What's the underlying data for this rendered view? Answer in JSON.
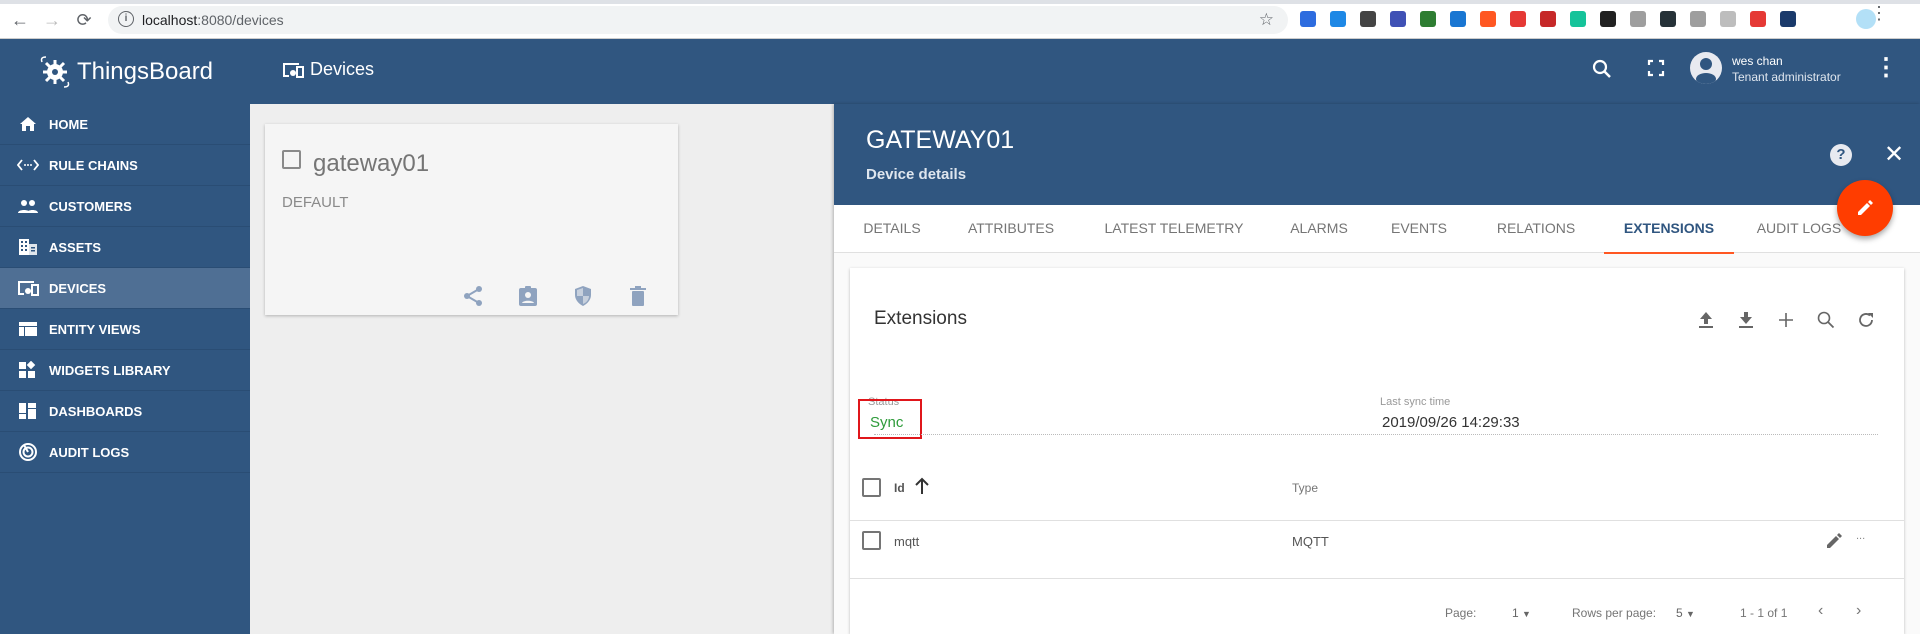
{
  "browser": {
    "url_host": "localhost",
    "url_path": ":8080/devices",
    "extension_colors": [
      "#2d6cdf",
      "#1e88e5",
      "#444444",
      "#3f51b5",
      "#2e7d32",
      "#1976d2",
      "#ff5722",
      "#e53935",
      "#c62828",
      "#15c39a",
      "#212121",
      "#9e9e9e",
      "#263238",
      "#9e9e9e",
      "#bdbdbd",
      "#e53935",
      "#1a3a6b"
    ]
  },
  "app": {
    "brand": "ThingsBoard",
    "page_title": "Devices",
    "user": {
      "name": "wes chan",
      "role": "Tenant administrator"
    }
  },
  "sidebar": {
    "items": [
      {
        "label": "HOME",
        "icon": "home-icon"
      },
      {
        "label": "RULE CHAINS",
        "icon": "rule-chains-icon"
      },
      {
        "label": "CUSTOMERS",
        "icon": "customers-icon"
      },
      {
        "label": "ASSETS",
        "icon": "assets-icon"
      },
      {
        "label": "DEVICES",
        "icon": "devices-icon",
        "active": true
      },
      {
        "label": "ENTITY VIEWS",
        "icon": "entity-views-icon"
      },
      {
        "label": "WIDGETS LIBRARY",
        "icon": "widgets-icon"
      },
      {
        "label": "DASHBOARDS",
        "icon": "dashboards-icon"
      },
      {
        "label": "AUDIT LOGS",
        "icon": "audit-logs-icon"
      }
    ]
  },
  "device_card": {
    "name": "gateway01",
    "type": "DEFAULT",
    "actions": [
      "share-icon",
      "assign-customer-icon",
      "credentials-icon",
      "delete-icon"
    ]
  },
  "detail": {
    "title": "GATEWAY01",
    "subtitle": "Device details",
    "tabs": [
      {
        "label": "DETAILS"
      },
      {
        "label": "ATTRIBUTES"
      },
      {
        "label": "LATEST TELEMETRY"
      },
      {
        "label": "ALARMS"
      },
      {
        "label": "EVENTS"
      },
      {
        "label": "RELATIONS"
      },
      {
        "label": "EXTENSIONS",
        "active": true
      },
      {
        "label": "AUDIT LOGS"
      }
    ],
    "extensions": {
      "title": "Extensions",
      "status_label": "Status",
      "status_value": "Sync",
      "status_color": "#2e9b3a",
      "last_sync_label": "Last sync time",
      "last_sync_value": "2019/09/26 14:29:33",
      "columns": {
        "id": "Id",
        "type": "Type"
      },
      "rows": [
        {
          "id": "mqtt",
          "type": "MQTT"
        }
      ],
      "row_more": "...",
      "pagination": {
        "page_label": "Page:",
        "page_value": "1",
        "rows_label": "Rows per page:",
        "rows_value": "5",
        "range": "1 - 1 of 1"
      }
    }
  },
  "colors": {
    "primary": "#305680",
    "accent": "#ff3d00",
    "tab_indicator": "#ff5722"
  }
}
